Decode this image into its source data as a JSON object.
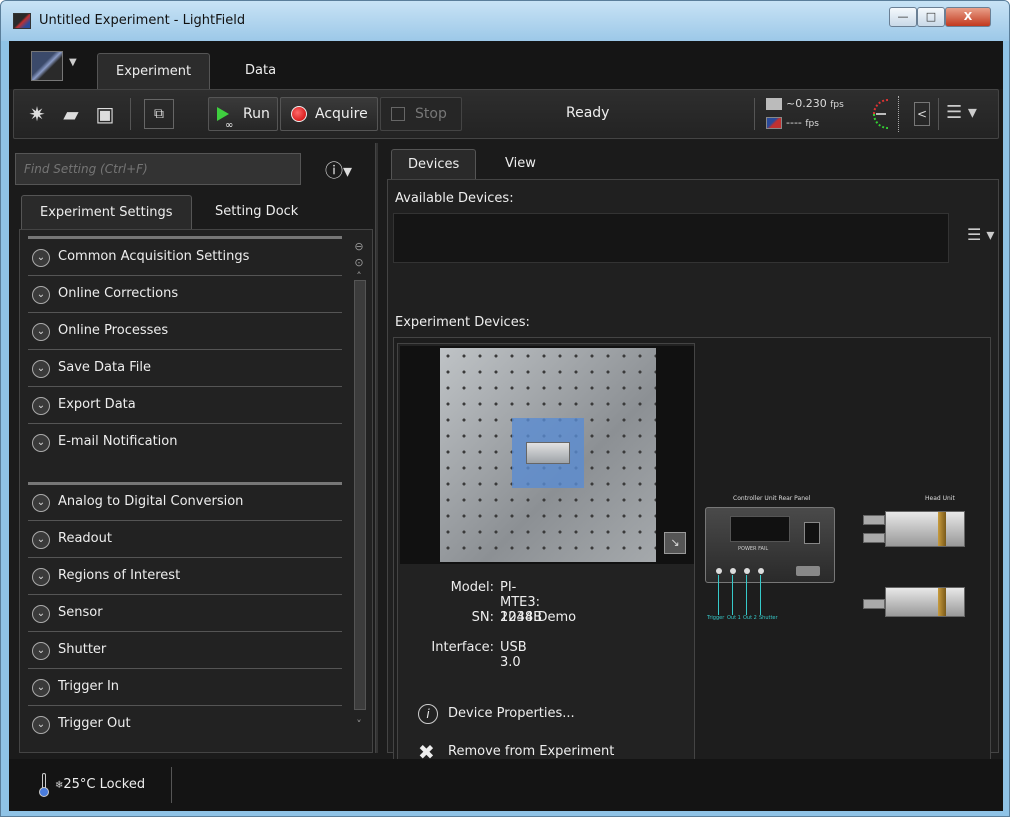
{
  "window": {
    "title": "Untitled Experiment - LightField",
    "minimize": "—",
    "maximize": "□",
    "close": "X"
  },
  "top_tabs": [
    {
      "label": "Experiment",
      "selected": true
    },
    {
      "label": "Data",
      "selected": false
    }
  ],
  "toolbar": {
    "run_label": "Run",
    "acquire_label": "Acquire",
    "stop_label": "Stop",
    "status": "Ready",
    "fps_value_1": "~0.230",
    "fps_unit_1": "fps",
    "fps_value_2": "----",
    "fps_unit_2": "fps",
    "icons": [
      "new-experiment-icon",
      "open-folder-icon",
      "save-icon",
      "preview-icon",
      "menu-icon"
    ],
    "colors": {
      "run": "#3fcf3f",
      "acquire": "#d10000"
    }
  },
  "left_panel": {
    "search_placeholder": "Find Setting (Ctrl+F)",
    "tabs": [
      {
        "label": "Experiment Settings",
        "selected": true
      },
      {
        "label": "Setting Dock",
        "selected": false
      }
    ],
    "group1": [
      "Common Acquisition Settings",
      "Online Corrections",
      "Online Processes",
      "Save Data File",
      "Export Data",
      "E-mail Notification"
    ],
    "group2": [
      "Analog to Digital Conversion",
      "Readout",
      "Regions of Interest",
      "Sensor",
      "Shutter",
      "Trigger In",
      "Trigger Out"
    ]
  },
  "right_panel": {
    "tabs": [
      {
        "label": "Devices",
        "selected": true
      },
      {
        "label": "View",
        "selected": false
      }
    ],
    "available_label": "Available Devices:",
    "experiment_label": "Experiment Devices:",
    "device": {
      "model_key": "Model:",
      "model_val": "PI-MTE3: 2048B",
      "sn_key": "SN:",
      "sn_val": "1234:Demo",
      "interface_key": "Interface:",
      "interface_val": "USB 3.0",
      "properties_label": "Device Properties...",
      "remove_label": "Remove from Experiment"
    },
    "diagram": {
      "controller_title": "Controller Unit Rear Panel",
      "head_title": "Head Unit",
      "power_label": "POWER FAIL",
      "ports": [
        "Trigger",
        "Out 1",
        "Out 2",
        "Shutter"
      ]
    }
  },
  "status_bar": {
    "temperature": "25°C Locked"
  }
}
